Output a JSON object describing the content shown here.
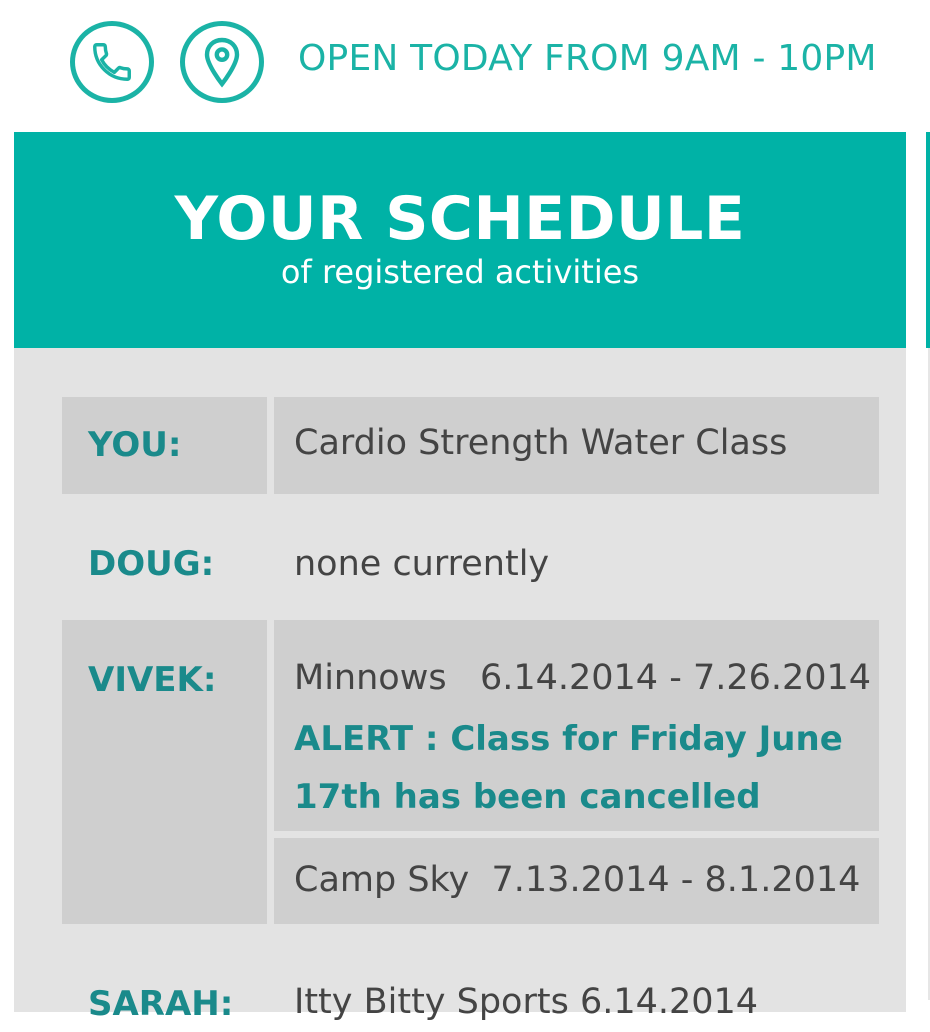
{
  "header": {
    "hours": "OPEN TODAY FROM 9AM - 10PM",
    "icons": [
      "phone-icon",
      "map-pin-icon"
    ],
    "accent_color": "#1bb3a6"
  },
  "schedule": {
    "title": "YOUR SCHEDULE",
    "subtitle": "of registered activities",
    "header_color": "#00b2a6",
    "rows": [
      {
        "name": "YOU:",
        "activities": [
          {
            "text": "Cardio Strength Water Class"
          }
        ]
      },
      {
        "name": "DOUG:",
        "activities": [
          {
            "text": "none currently"
          }
        ]
      },
      {
        "name": "VIVEK:",
        "activities": [
          {
            "text": "Minnows   6.14.2014 - 7.26.2014",
            "alert": "ALERT : Class for Friday June 17th has been cancelled"
          },
          {
            "text": "Camp Sky  7.13.2014 - 8.1.2014"
          }
        ]
      },
      {
        "name": "SARAH:",
        "activities": [
          {
            "text": "Itty Bitty Sports  6.14.2014"
          }
        ]
      }
    ]
  }
}
